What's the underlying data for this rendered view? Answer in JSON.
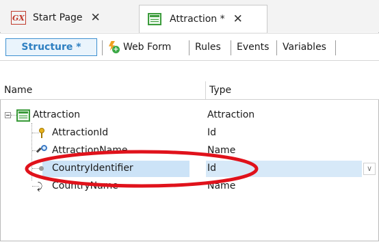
{
  "tabs": [
    {
      "label": "Start Page",
      "icon": "gx-icon",
      "close": "✕"
    },
    {
      "label": "Attraction *",
      "icon": "transaction-icon",
      "close": "✕"
    }
  ],
  "toolbar": {
    "structure": "Structure *",
    "web_form": "Web Form",
    "rules": "Rules",
    "events": "Events",
    "variables": "Variables"
  },
  "grid": {
    "columns": [
      "Name",
      "Type"
    ],
    "rows": [
      {
        "name": "Attraction",
        "type": "Attraction",
        "icon": "transaction-icon"
      },
      {
        "name": "AttractionId",
        "type": "Id",
        "icon": "key-icon"
      },
      {
        "name": "AttractionName",
        "type": "Name",
        "icon": "search-icon"
      },
      {
        "name": "CountryIdentifier",
        "type": "Id",
        "icon": "dot-icon",
        "selected": true
      },
      {
        "name": "CountryName",
        "type": "Name",
        "icon": "arrow-icon"
      }
    ]
  },
  "colors": {
    "accent": "#2d7fc1",
    "selection": "#cce3f7",
    "annotation": "#e0121b"
  }
}
